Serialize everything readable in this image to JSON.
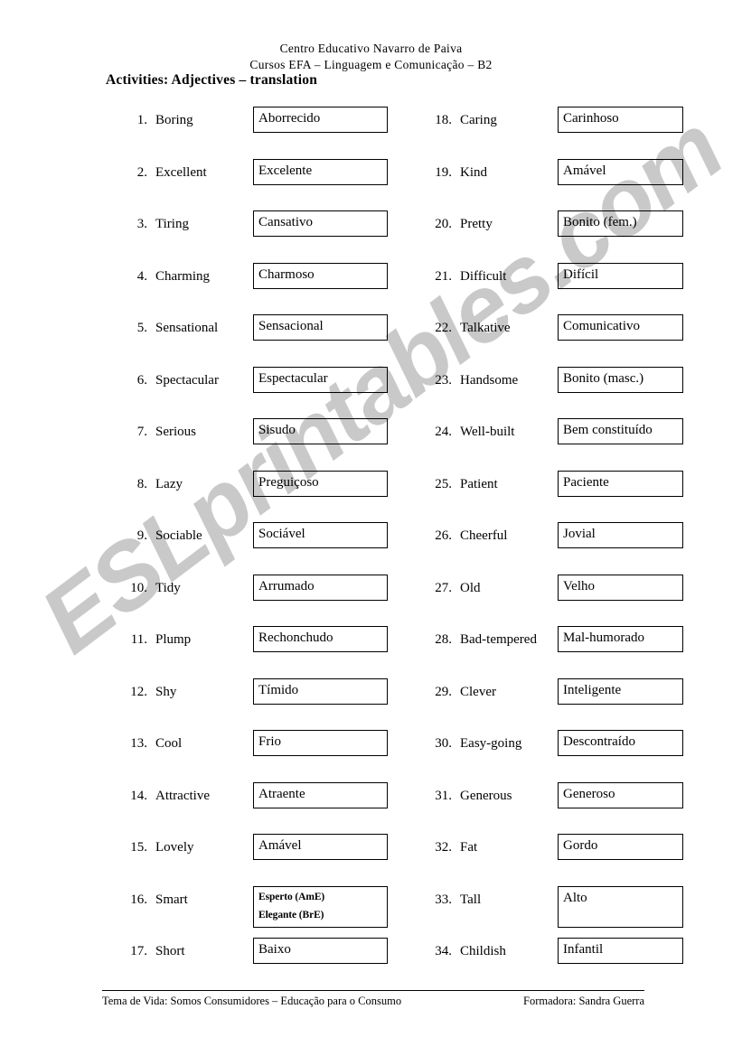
{
  "header": {
    "school": "Centro Educativo Navarro de Paiva",
    "course": "Cursos EFA – Linguagem e Comunicação – B2",
    "title": "Activities: Adjectives – translation"
  },
  "watermark": {
    "text": "ESLprintables.com",
    "color": "#c9c9c9"
  },
  "left_column": [
    {
      "num": "1.",
      "term": "Boring",
      "answer": "Aborrecido"
    },
    {
      "num": "2.",
      "term": "Excellent",
      "answer": "Excelente"
    },
    {
      "num": "3.",
      "term": "Tiring",
      "answer": "Cansativo"
    },
    {
      "num": "4.",
      "term": "Charming",
      "answer": "Charmoso"
    },
    {
      "num": "5.",
      "term": "Sensational",
      "answer": "Sensacional"
    },
    {
      "num": "6.",
      "term": "Spectacular",
      "answer": "Espectacular"
    },
    {
      "num": "7.",
      "term": "Serious",
      "answer": "Sisudo"
    },
    {
      "num": "8.",
      "term": "Lazy",
      "answer": "Preguiçoso"
    },
    {
      "num": "9.",
      "term": "Sociable",
      "answer": "Sociável"
    },
    {
      "num": "10.",
      "term": "Tidy",
      "answer": "Arrumado"
    },
    {
      "num": "11.",
      "term": "Plump",
      "answer": "Rechonchudo"
    },
    {
      "num": "12.",
      "term": "Shy",
      "answer": "Tímido"
    },
    {
      "num": "13.",
      "term": "Cool",
      "answer": "Frio"
    },
    {
      "num": "14.",
      "term": "Attractive",
      "answer": "Atraente"
    },
    {
      "num": "15.",
      "term": "Lovely",
      "answer": "Amável"
    },
    {
      "num": "16.",
      "term": "Smart",
      "answer": "Esperto (AmE)",
      "answer2": "Elegante (BrE)"
    },
    {
      "num": "17.",
      "term": "Short",
      "answer": "Baixo"
    }
  ],
  "right_column": [
    {
      "num": "18.",
      "term": "Caring",
      "answer": "Carinhoso"
    },
    {
      "num": "19.",
      "term": "Kind",
      "answer": "Amável"
    },
    {
      "num": "20.",
      "term": "Pretty",
      "answer": "Bonito (fem.)"
    },
    {
      "num": "21.",
      "term": "Difficult",
      "answer": "Difícil"
    },
    {
      "num": "22.",
      "term": "Talkative",
      "answer": "Comunicativo"
    },
    {
      "num": "23.",
      "term": "Handsome",
      "answer": "Bonito (masc.)"
    },
    {
      "num": "24.",
      "term": "Well-built",
      "answer": "Bem constituído"
    },
    {
      "num": "25.",
      "term": "Patient",
      "answer": "Paciente"
    },
    {
      "num": "26.",
      "term": "Cheerful",
      "answer": "Jovial"
    },
    {
      "num": "27.",
      "term": "Old",
      "answer": "Velho"
    },
    {
      "num": "28.",
      "term": "Bad-tempered",
      "answer": "Mal-humorado"
    },
    {
      "num": "29.",
      "term": "Clever",
      "answer": "Inteligente"
    },
    {
      "num": "30.",
      "term": "Easy-going",
      "answer": "Descontraído"
    },
    {
      "num": "31.",
      "term": "Generous",
      "answer": "Generoso"
    },
    {
      "num": "32.",
      "term": "Fat",
      "answer": "Gordo"
    },
    {
      "num": "33.",
      "term": "Tall",
      "answer": "Alto",
      "tall_box": true
    },
    {
      "num": "34.",
      "term": "Childish",
      "answer": "Infantil"
    }
  ],
  "footer": {
    "left": "Tema de Vida: Somos Consumidores – Educação para o Consumo",
    "right": "Formadora: Sandra Guerra"
  }
}
